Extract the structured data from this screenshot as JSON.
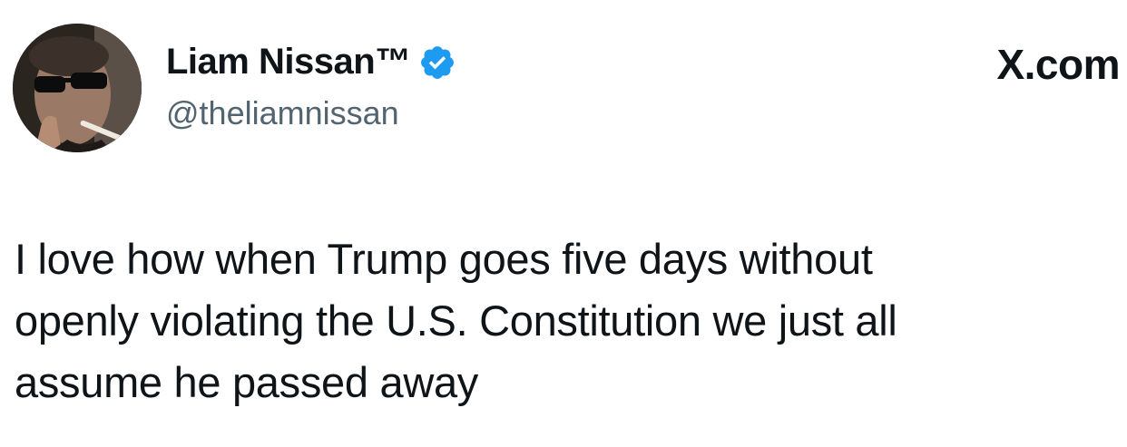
{
  "author": {
    "display_name": "Liam Nissan™",
    "handle": "@theliamnissan",
    "verified": true,
    "avatar_icon": "profile-photo-sunglasses"
  },
  "site": {
    "label": "X.com"
  },
  "tweet": {
    "lines": [
      "I love how when Trump goes five days without",
      "openly violating the U.S. Constitution we just all",
      "assume he passed away"
    ]
  },
  "colors": {
    "verified_badge": "#1d9bf0",
    "text": "#0f1419",
    "handle": "#536471"
  }
}
